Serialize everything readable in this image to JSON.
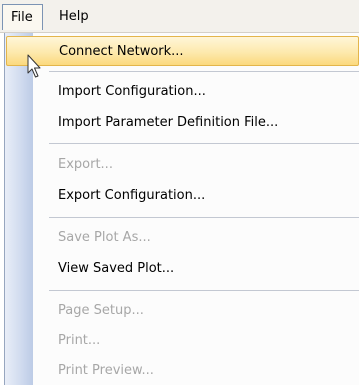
{
  "menubar": {
    "file": "File",
    "help": "Help"
  },
  "file_menu": {
    "connect_network": "Connect Network...",
    "import_configuration": "Import Configuration...",
    "import_parameter_definition_file": "Import Parameter Definition File...",
    "export": "Export...",
    "export_configuration": "Export Configuration...",
    "save_plot_as": "Save Plot As...",
    "view_saved_plot": "View Saved Plot...",
    "page_setup": "Page Setup...",
    "print": "Print...",
    "print_preview": "Print Preview..."
  },
  "colors": {
    "highlight_border": "#e3b54b",
    "disabled_text": "#a7a7a7",
    "gutter": "#cfdaee"
  }
}
